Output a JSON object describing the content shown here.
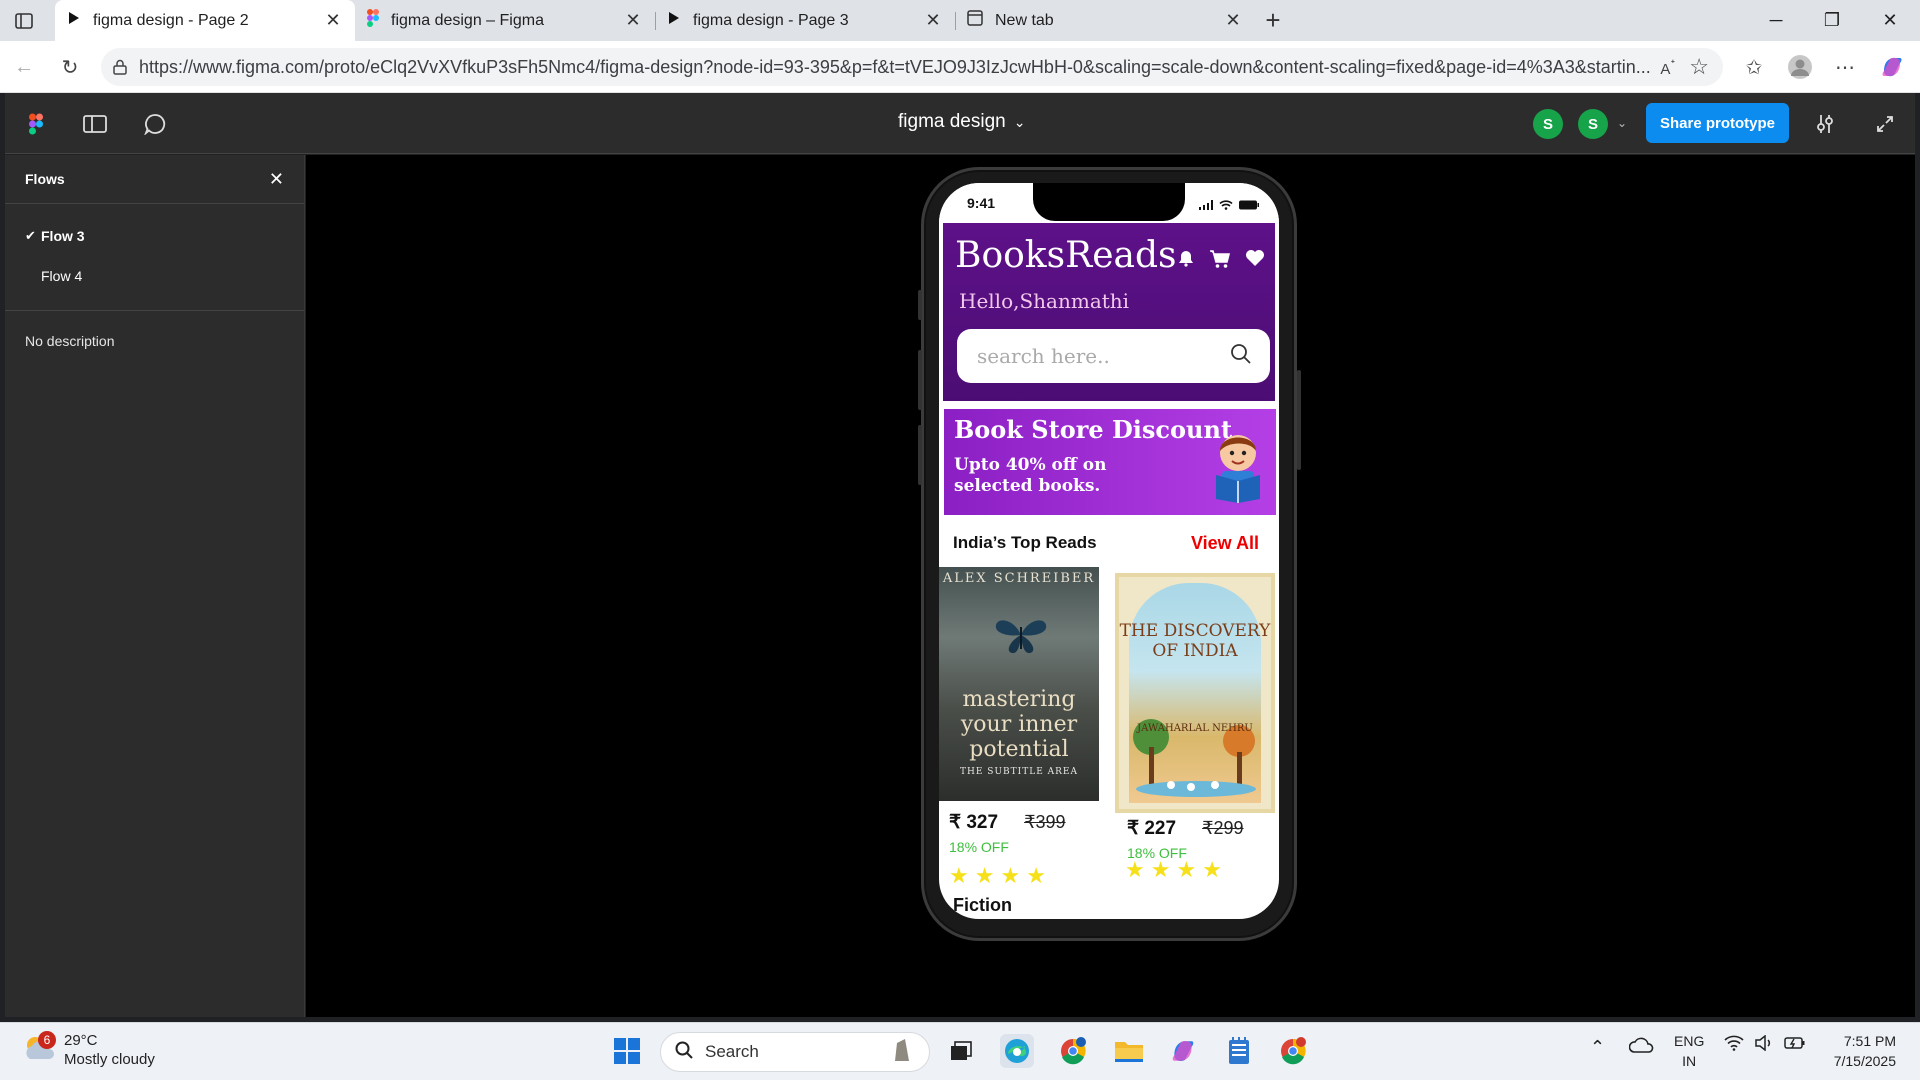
{
  "browser": {
    "tabs": [
      {
        "title": "figma design - Page 2",
        "active": true,
        "icon": "play-icon"
      },
      {
        "title": "figma design – Figma",
        "active": false,
        "icon": "figma-icon"
      },
      {
        "title": "figma design - Page 3",
        "active": false,
        "icon": "play-icon"
      },
      {
        "title": "New tab",
        "active": false,
        "icon": "newtab-icon"
      }
    ],
    "url": "https://www.figma.com/proto/eClq2VvXVfkuP3sFh5Nmc4/figma-design?node-id=93-395&p=f&t=tVEJO9J3IzJcwHbH-0&scaling=scale-down&content-scaling=fixed&page-id=4%3A3&startin..."
  },
  "figma": {
    "file_title": "figma design",
    "avatars": [
      "S",
      "S"
    ],
    "share_label": "Share prototype",
    "accent_color": "#0d8cf0"
  },
  "sidebar": {
    "title": "Flows",
    "flows": [
      {
        "label": "Flow 3",
        "selected": true
      },
      {
        "label": "Flow 4",
        "selected": false
      }
    ],
    "description": "No description"
  },
  "phone": {
    "status_time": "9:41",
    "app": {
      "brand": "BooksReads",
      "greeting": "Hello,Shanmathi",
      "search_placeholder": "search here..",
      "banner": {
        "title": "Book Store Discount",
        "subtitle": "Upto 40% off on selected books."
      },
      "section_title": "India’s Top Reads",
      "view_all": "View All",
      "books": [
        {
          "author_cover": "ALEX SCHREIBER",
          "title_cover": "mastering your inner potential",
          "subtitle_cover": "THE SUBTITLE AREA",
          "price": "₹ 327",
          "old_price": "₹399",
          "discount": "18% OFF",
          "rating": 4
        },
        {
          "title_cover": "THE DISCOVERY OF INDIA",
          "author_cover": "JAWAHARLAL NEHRU",
          "price": "₹ 227",
          "old_price": "₹299",
          "discount": "18% OFF",
          "rating": 4
        }
      ],
      "genre": "Fiction",
      "header_color": "#5e1189"
    }
  },
  "taskbar": {
    "weather_badge": "6",
    "temperature": "29°C",
    "weather": "Mostly cloudy",
    "search_label": "Search",
    "lang_top": "ENG",
    "lang_bottom": "IN",
    "time": "7:51 PM",
    "date": "7/15/2025"
  }
}
